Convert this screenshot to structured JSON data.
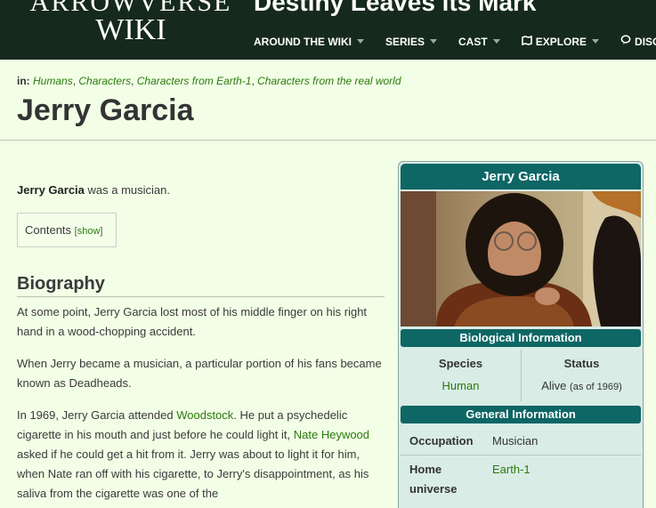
{
  "header": {
    "logo_line1": "ARROWVERSE",
    "logo_line2": "WIKI",
    "community_title": "Destiny Leaves its Mark",
    "nav": [
      {
        "label": "AROUND THE WIKI",
        "icon": ""
      },
      {
        "label": "SERIES",
        "icon": ""
      },
      {
        "label": "CAST",
        "icon": ""
      },
      {
        "label": "EXPLORE",
        "icon": "explore-icon"
      },
      {
        "label": "DISC",
        "icon": "discussions-icon"
      }
    ]
  },
  "categories": {
    "label": "in:",
    "items": [
      "Humans",
      "Characters",
      "Characters from Earth-1",
      "Characters from the real world"
    ]
  },
  "page_title": "Jerry Garcia",
  "article": {
    "intro_bold": "Jerry Garcia",
    "intro_rest": " was a musician.",
    "toc_label": "Contents",
    "toc_show": "show",
    "section_heading": "Biography",
    "p1": "At some point, Jerry Garcia lost most of his middle finger on his right hand in a wood-chopping accident.",
    "p2": "When Jerry became a musician, a particular portion of his fans became known as Deadheads.",
    "p3": {
      "t1": "In 1969, Jerry Garcia attended ",
      "link1": "Woodstock",
      "t2": ". He put a psychedelic cigarette in his mouth and just before he could light it, ",
      "link2": "Nate Heywood",
      "t3": " asked if he could get a hit from it. Jerry was about to light it for him, when Nate ran off with his cigarette, to Jerry's disappointment, as his saliva from the cigarette was one of the"
    }
  },
  "infobox": {
    "title": "Jerry Garcia",
    "bio_heading": "Biological Information",
    "species_label": "Species",
    "species_value": "Human",
    "status_label": "Status",
    "status_value": "Alive",
    "status_note": "(as of 1969)",
    "general_heading": "General Information",
    "occupation_label": "Occupation",
    "occupation_value": "Musician",
    "home_label": "Home universe",
    "home_value": "Earth-1"
  }
}
